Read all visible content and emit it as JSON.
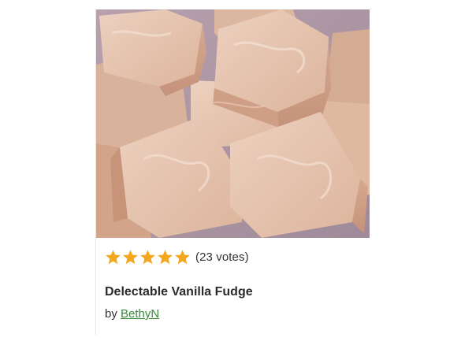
{
  "recipe": {
    "rating": {
      "value": 5,
      "max": 5,
      "star_color": "#f4a81d",
      "votes_text": "(23 votes)"
    },
    "title": "Delectable Vanilla Fudge",
    "byline": {
      "prefix": "by",
      "author": "BethyN",
      "author_color": "#3a8a3a"
    },
    "image": {
      "subject": "vanilla fudge squares",
      "dominant_color": "#e3bfa8"
    }
  }
}
